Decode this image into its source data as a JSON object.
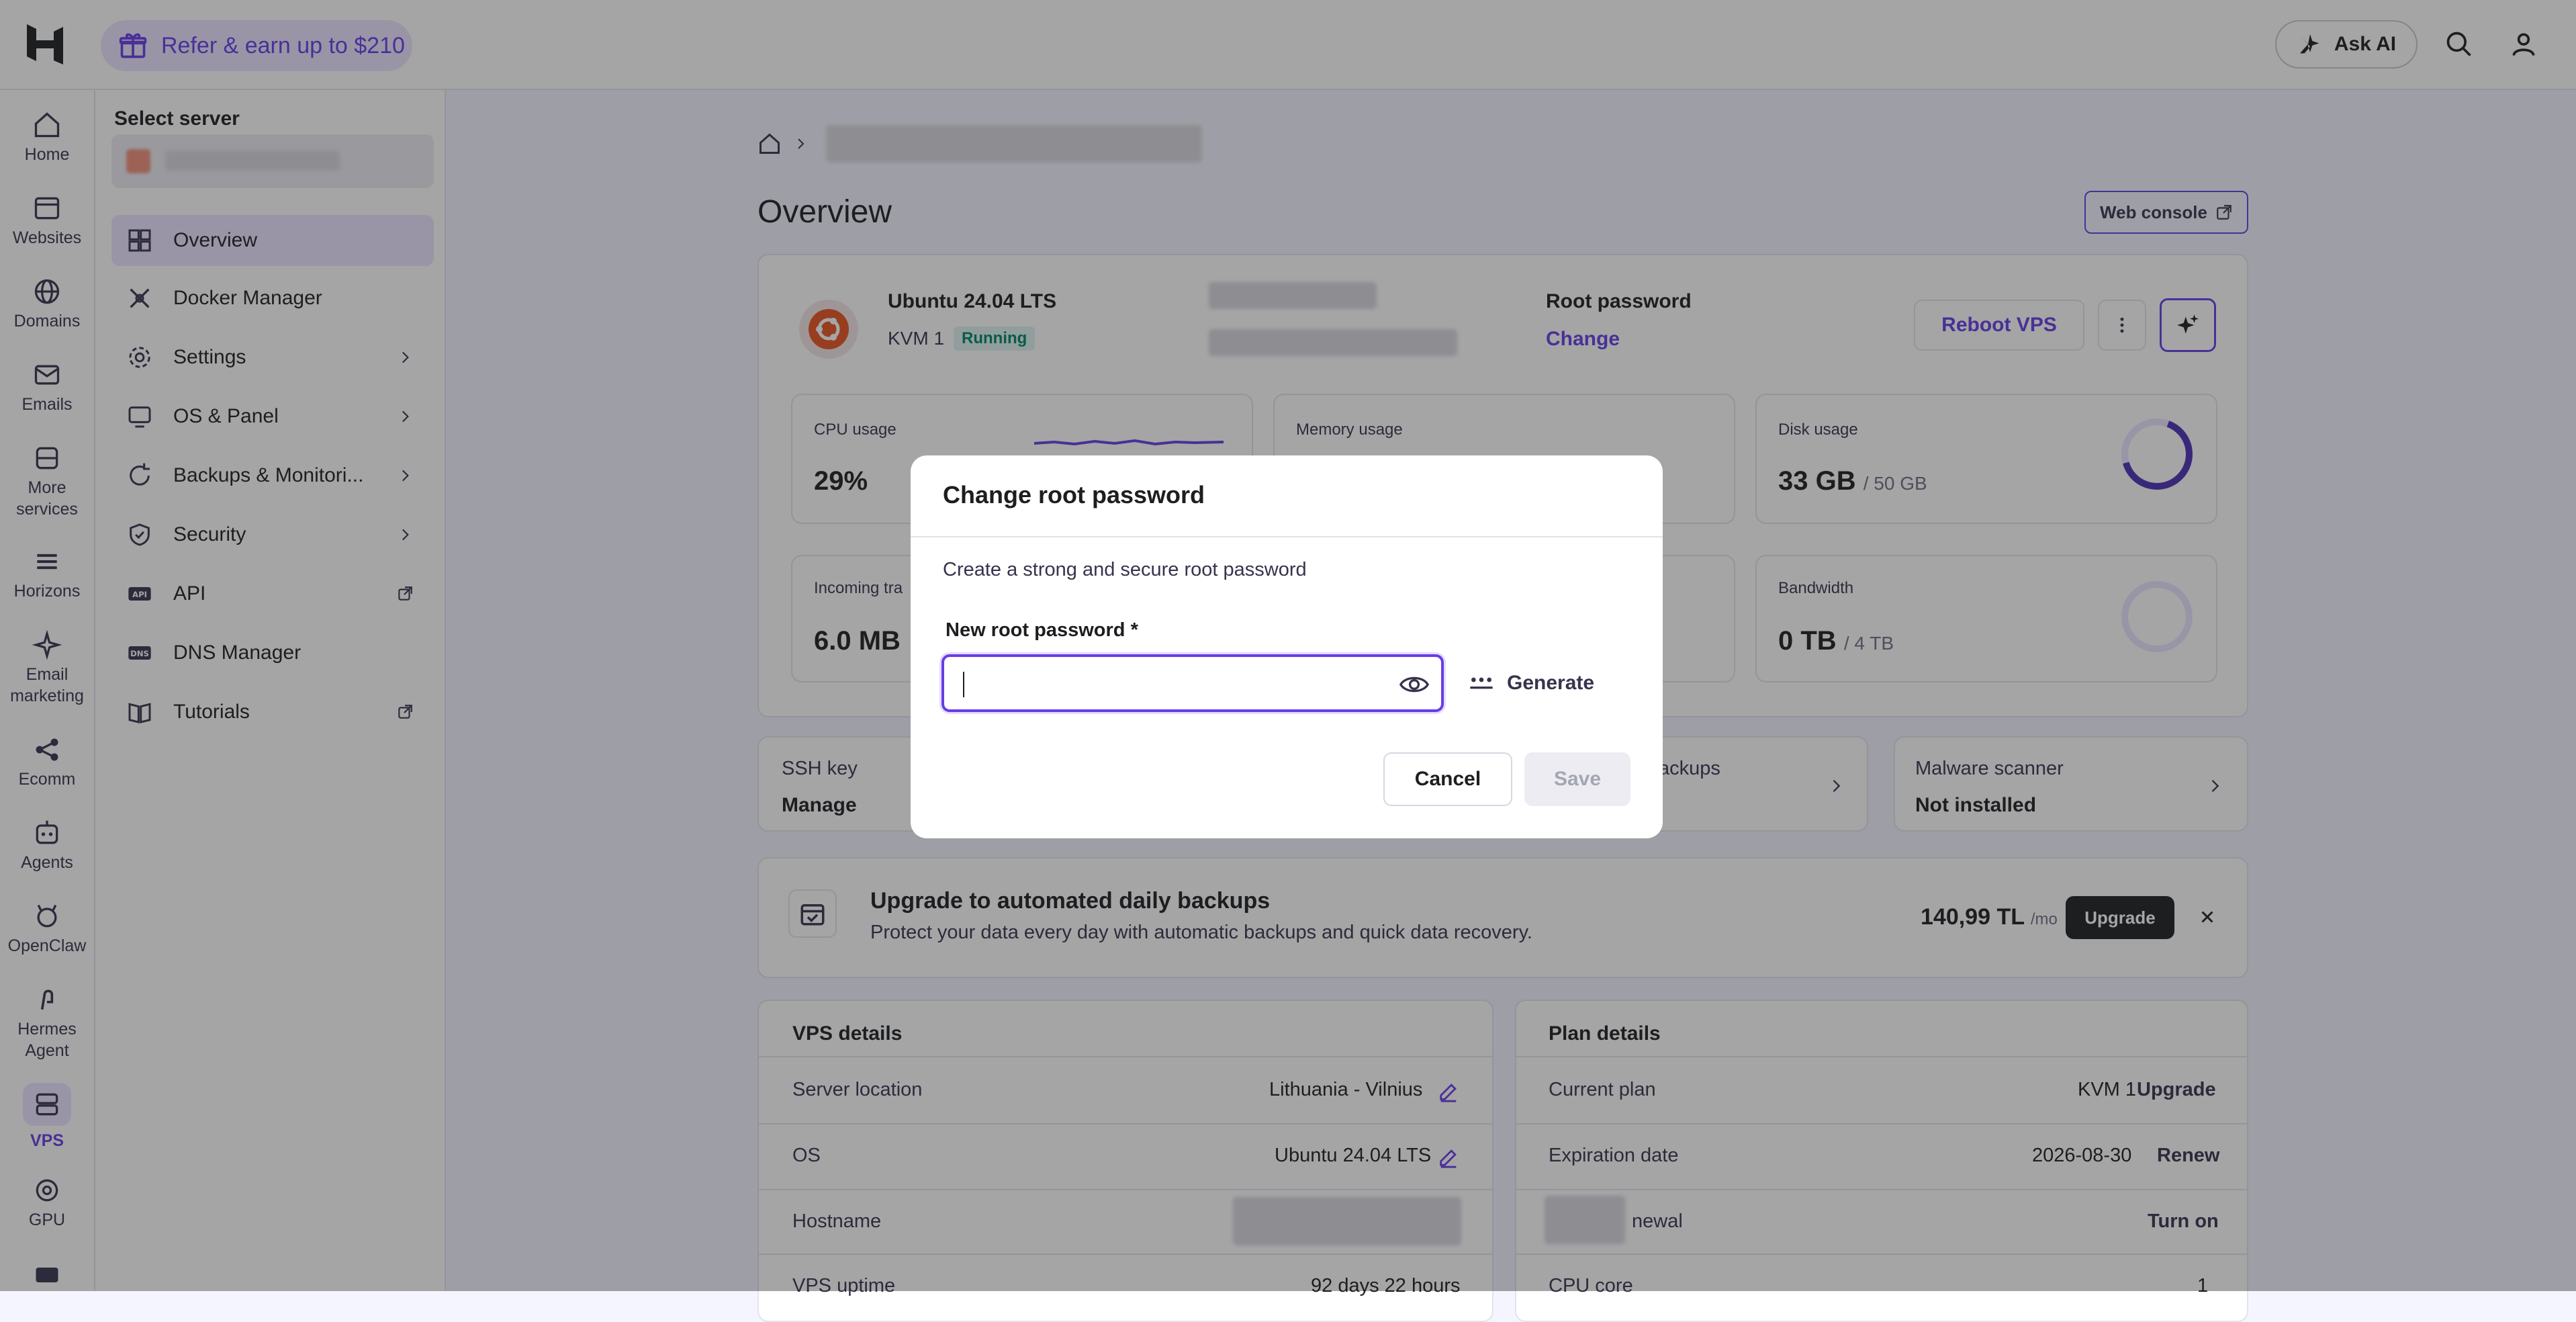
{
  "topbar": {
    "refer_label": "Refer & earn up to $210",
    "ask_ai_label": "Ask AI"
  },
  "rail": [
    {
      "label": "Home",
      "icon": "home-icon"
    },
    {
      "label": "Websites",
      "icon": "browser-icon"
    },
    {
      "label": "Domains",
      "icon": "globe-icon"
    },
    {
      "label": "Emails",
      "icon": "mail-icon"
    },
    {
      "label": "More services",
      "icon": "box-icon"
    },
    {
      "label": "Horizons",
      "icon": "horizons-icon"
    },
    {
      "label": "Email marketing",
      "icon": "sparkle-icon"
    },
    {
      "label": "Ecomm",
      "icon": "share-icon"
    },
    {
      "label": "Agents",
      "icon": "agent-icon"
    },
    {
      "label": "OpenClaw",
      "icon": "claw-icon"
    },
    {
      "label": "Hermes Agent",
      "icon": "hermes-icon"
    },
    {
      "label": "VPS",
      "icon": "server-icon"
    },
    {
      "label": "GPU",
      "icon": "gpu-icon"
    }
  ],
  "sidebar": {
    "title": "Select server",
    "items": [
      {
        "label": "Overview",
        "icon": "grid-icon"
      },
      {
        "label": "Docker Manager",
        "icon": "docker-icon"
      },
      {
        "label": "Settings",
        "icon": "gear-icon"
      },
      {
        "label": "OS & Panel",
        "icon": "monitor-icon"
      },
      {
        "label": "Backups & Monitori...",
        "icon": "refresh-icon"
      },
      {
        "label": "Security",
        "icon": "shield-icon"
      },
      {
        "label": "API",
        "icon": "api-icon"
      },
      {
        "label": "DNS Manager",
        "icon": "dns-icon"
      },
      {
        "label": "Tutorials",
        "icon": "book-icon"
      }
    ]
  },
  "main": {
    "title": "Overview",
    "web_console": "Web console",
    "server": {
      "os": "Ubuntu 24.04 LTS",
      "plan": "KVM 1",
      "status": "Running",
      "root_password_label": "Root password",
      "root_password_action": "Change",
      "reboot_label": "Reboot VPS"
    },
    "metrics": {
      "cpu_label": "CPU usage",
      "cpu_value": "29%",
      "memory_label": "Memory usage",
      "disk_label": "Disk usage",
      "disk_value": "33 GB",
      "disk_total": "/ 50 GB",
      "incoming_label": "Incoming tra",
      "incoming_value": "6.0 MB",
      "bandwidth_label": "Bandwidth",
      "bandwidth_value": "0 TB",
      "bandwidth_total": "/ 4 TB"
    },
    "quick": {
      "ssh_label": "SSH key",
      "ssh_action": "Manage",
      "backups_label": "ackups",
      "malware_label": "Malware scanner",
      "malware_value": "Not installed"
    },
    "upgrade": {
      "title": "Upgrade to automated daily backups",
      "desc": "Protect your data every day with automatic backups and quick data recovery.",
      "price": "140,99 TL",
      "per": "/mo",
      "button": "Upgrade"
    },
    "vps_details": {
      "title": "VPS details",
      "rows": [
        {
          "key": "Server location",
          "value": "Lithuania - Vilnius"
        },
        {
          "key": "OS",
          "value": "Ubuntu 24.04 LTS"
        },
        {
          "key": "Hostname",
          "value": ""
        },
        {
          "key": "VPS uptime",
          "value": "92 days 22 hours"
        }
      ]
    },
    "plan_details": {
      "title": "Plan details",
      "rows": [
        {
          "key": "Current plan",
          "value": "KVM 1",
          "action": "Upgrade"
        },
        {
          "key": "Expiration date",
          "value": "2026-08-30",
          "action": "Renew"
        },
        {
          "key": "newal",
          "value": "",
          "action": "Turn on"
        },
        {
          "key": "CPU core",
          "value": "1",
          "action": ""
        }
      ]
    }
  },
  "modal": {
    "title": "Change root password",
    "description": "Create a strong and secure root password",
    "field_label": "New root password",
    "required_mark": "*",
    "field_value": "",
    "generate_label": "Generate",
    "cancel_label": "Cancel",
    "save_label": "Save"
  },
  "colors": {
    "accent": "#673de6",
    "accent_light": "#ebe4ff",
    "running": "#00b090",
    "overlay": "rgba(29,30,32,0.40)"
  }
}
